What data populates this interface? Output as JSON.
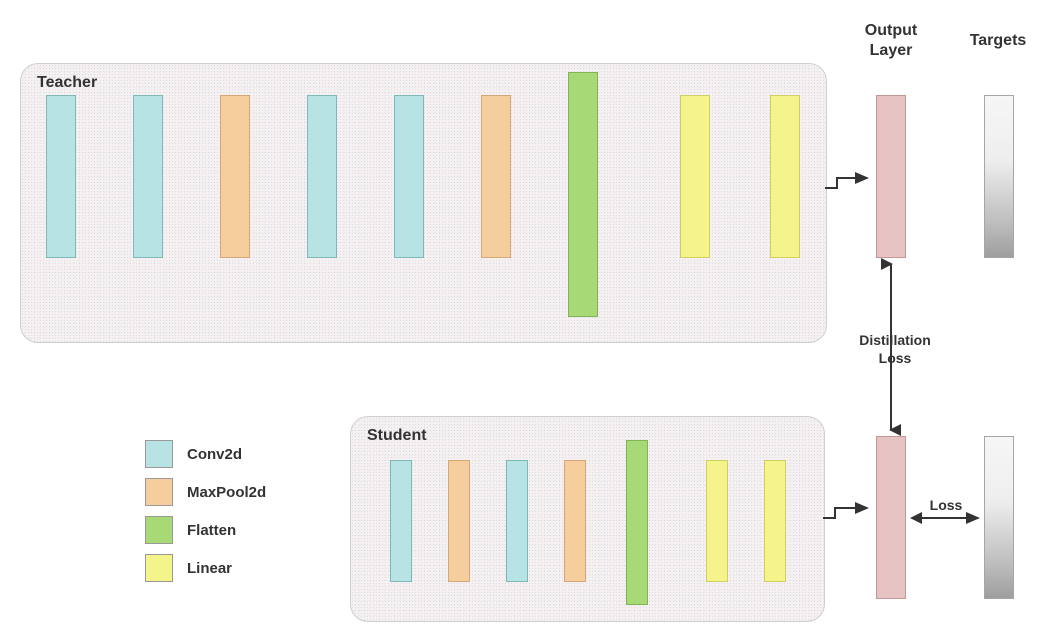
{
  "teacher": {
    "label": "Teacher",
    "layers": [
      {
        "type": "conv",
        "name": "teacher-conv-1"
      },
      {
        "type": "conv",
        "name": "teacher-conv-2"
      },
      {
        "type": "pool",
        "name": "teacher-pool-1"
      },
      {
        "type": "conv",
        "name": "teacher-conv-3"
      },
      {
        "type": "conv",
        "name": "teacher-conv-4"
      },
      {
        "type": "pool",
        "name": "teacher-pool-2"
      },
      {
        "type": "flat",
        "name": "teacher-flatten",
        "tall": true
      },
      {
        "type": "linear",
        "name": "teacher-linear-1"
      },
      {
        "type": "linear",
        "name": "teacher-linear-2"
      }
    ]
  },
  "student": {
    "label": "Student",
    "layers": [
      {
        "type": "conv",
        "name": "student-conv-1"
      },
      {
        "type": "pool",
        "name": "student-pool-1"
      },
      {
        "type": "conv",
        "name": "student-conv-2"
      },
      {
        "type": "pool",
        "name": "student-pool-2"
      },
      {
        "type": "flat",
        "name": "student-flatten",
        "tall": true
      },
      {
        "type": "linear",
        "name": "student-linear-1"
      },
      {
        "type": "linear",
        "name": "student-linear-2"
      }
    ]
  },
  "legend": {
    "items": [
      {
        "swatch": "conv",
        "label": "Conv2d"
      },
      {
        "swatch": "pool",
        "label": "MaxPool2d"
      },
      {
        "swatch": "flat",
        "label": "Flatten"
      },
      {
        "swatch": "linear",
        "label": "Linear"
      }
    ]
  },
  "columns": {
    "output_layer": "Output\nLayer",
    "targets": "Targets"
  },
  "losses": {
    "distill": "Distillation\nLoss",
    "loss": "Loss"
  },
  "colors": {
    "conv": "#b7e3e4",
    "pool": "#f6cd9c",
    "flat": "#a7d977",
    "linear": "#f5f48a",
    "output": "#e6c4c4"
  }
}
